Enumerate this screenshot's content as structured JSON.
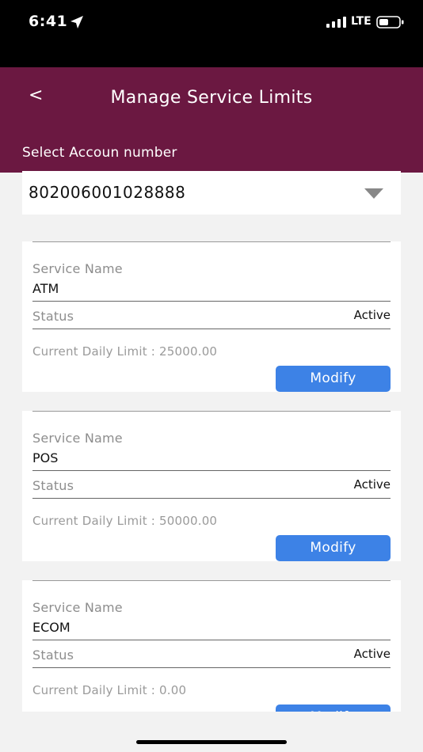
{
  "status_bar": {
    "time": "6:41",
    "network": "LTE",
    "icons": [
      "location-arrow-icon",
      "signal-bars-icon",
      "battery-icon"
    ]
  },
  "header": {
    "back": "<",
    "title": "Manage Service Limits",
    "select_label": "Select Accoun number",
    "color": "#6b1841"
  },
  "account": {
    "selected": "802006001028888",
    "icon": "dropdown-arrow-icon"
  },
  "services": [
    {
      "name_label": "Service Name",
      "name": "ATM",
      "status_label": "Status",
      "status": "Active",
      "limit_text": "Current Daily Limit : 25000.00",
      "button": "Modify"
    },
    {
      "name_label": "Service Name",
      "name": "POS",
      "status_label": "Status",
      "status": "Active",
      "limit_text": "Current Daily Limit : 50000.00",
      "button": "Modify"
    },
    {
      "name_label": "Service Name",
      "name": "ECOM",
      "status_label": "Status",
      "status": "Active",
      "limit_text": "Current Daily Limit : 0.00",
      "button": "Modify"
    }
  ],
  "colors": {
    "accent": "#3d82e6",
    "background": "#f2f2f2"
  }
}
